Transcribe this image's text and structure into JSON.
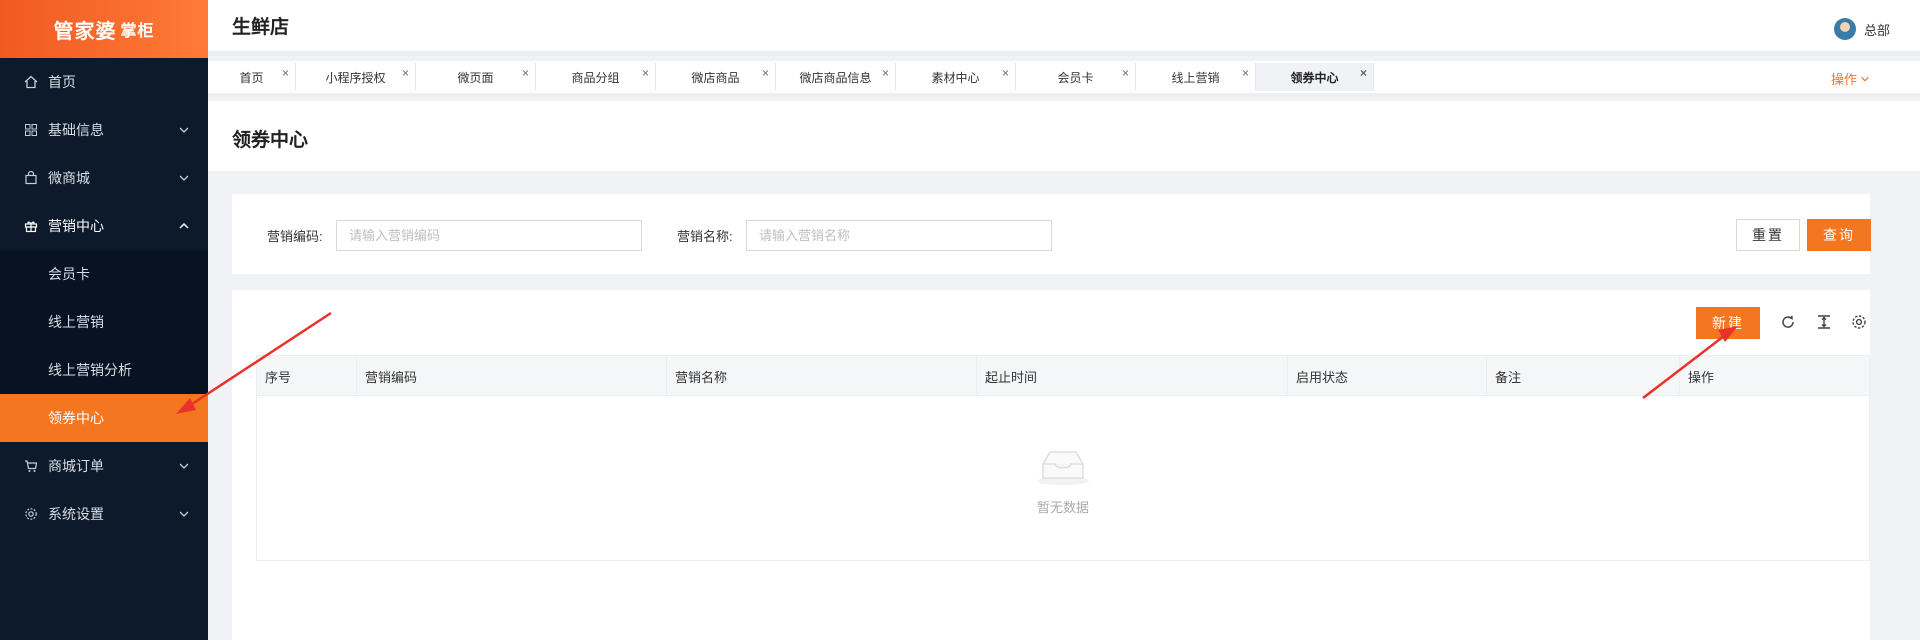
{
  "logo": {
    "main": "管家婆",
    "sub": "掌柜"
  },
  "header": {
    "store_name": "生鲜店",
    "user": "总部"
  },
  "sidebar": {
    "items": [
      {
        "label": "首页",
        "icon": "home-icon"
      },
      {
        "label": "基础信息",
        "icon": "grid-icon"
      },
      {
        "label": "微商城",
        "icon": "bag-icon"
      },
      {
        "label": "营销中心",
        "icon": "gift-icon"
      },
      {
        "label": "商城订单",
        "icon": "cart-icon"
      },
      {
        "label": "系统设置",
        "icon": "gear-icon"
      }
    ],
    "submenu": [
      {
        "label": "会员卡"
      },
      {
        "label": "线上营销"
      },
      {
        "label": "线上营销分析"
      },
      {
        "label": "领券中心"
      }
    ]
  },
  "tabs": [
    {
      "label": "首页"
    },
    {
      "label": "小程序授权"
    },
    {
      "label": "微页面"
    },
    {
      "label": "商品分组"
    },
    {
      "label": "微店商品"
    },
    {
      "label": "微店商品信息"
    },
    {
      "label": "素材中心"
    },
    {
      "label": "会员卡"
    },
    {
      "label": "线上营销"
    },
    {
      "label": "领券中心"
    }
  ],
  "tab_close": "×",
  "operations": "操作",
  "page_title": "领券中心",
  "search": {
    "code_label": "营销编码:",
    "code_placeholder": "请输入营销编码",
    "name_label": "营销名称:",
    "name_placeholder": "请输入营销名称",
    "reset": "重置",
    "query": "查询"
  },
  "toolbar": {
    "new": "新建"
  },
  "table": {
    "columns": [
      "序号",
      "营销编码",
      "营销名称",
      "起止时间",
      "启用状态",
      "备注",
      "操作"
    ],
    "rows": [],
    "empty_text": "暂无数据"
  },
  "colors": {
    "accent": "#f47621",
    "sidebar": "#0c1a2c",
    "arrow": "#e8332a"
  }
}
